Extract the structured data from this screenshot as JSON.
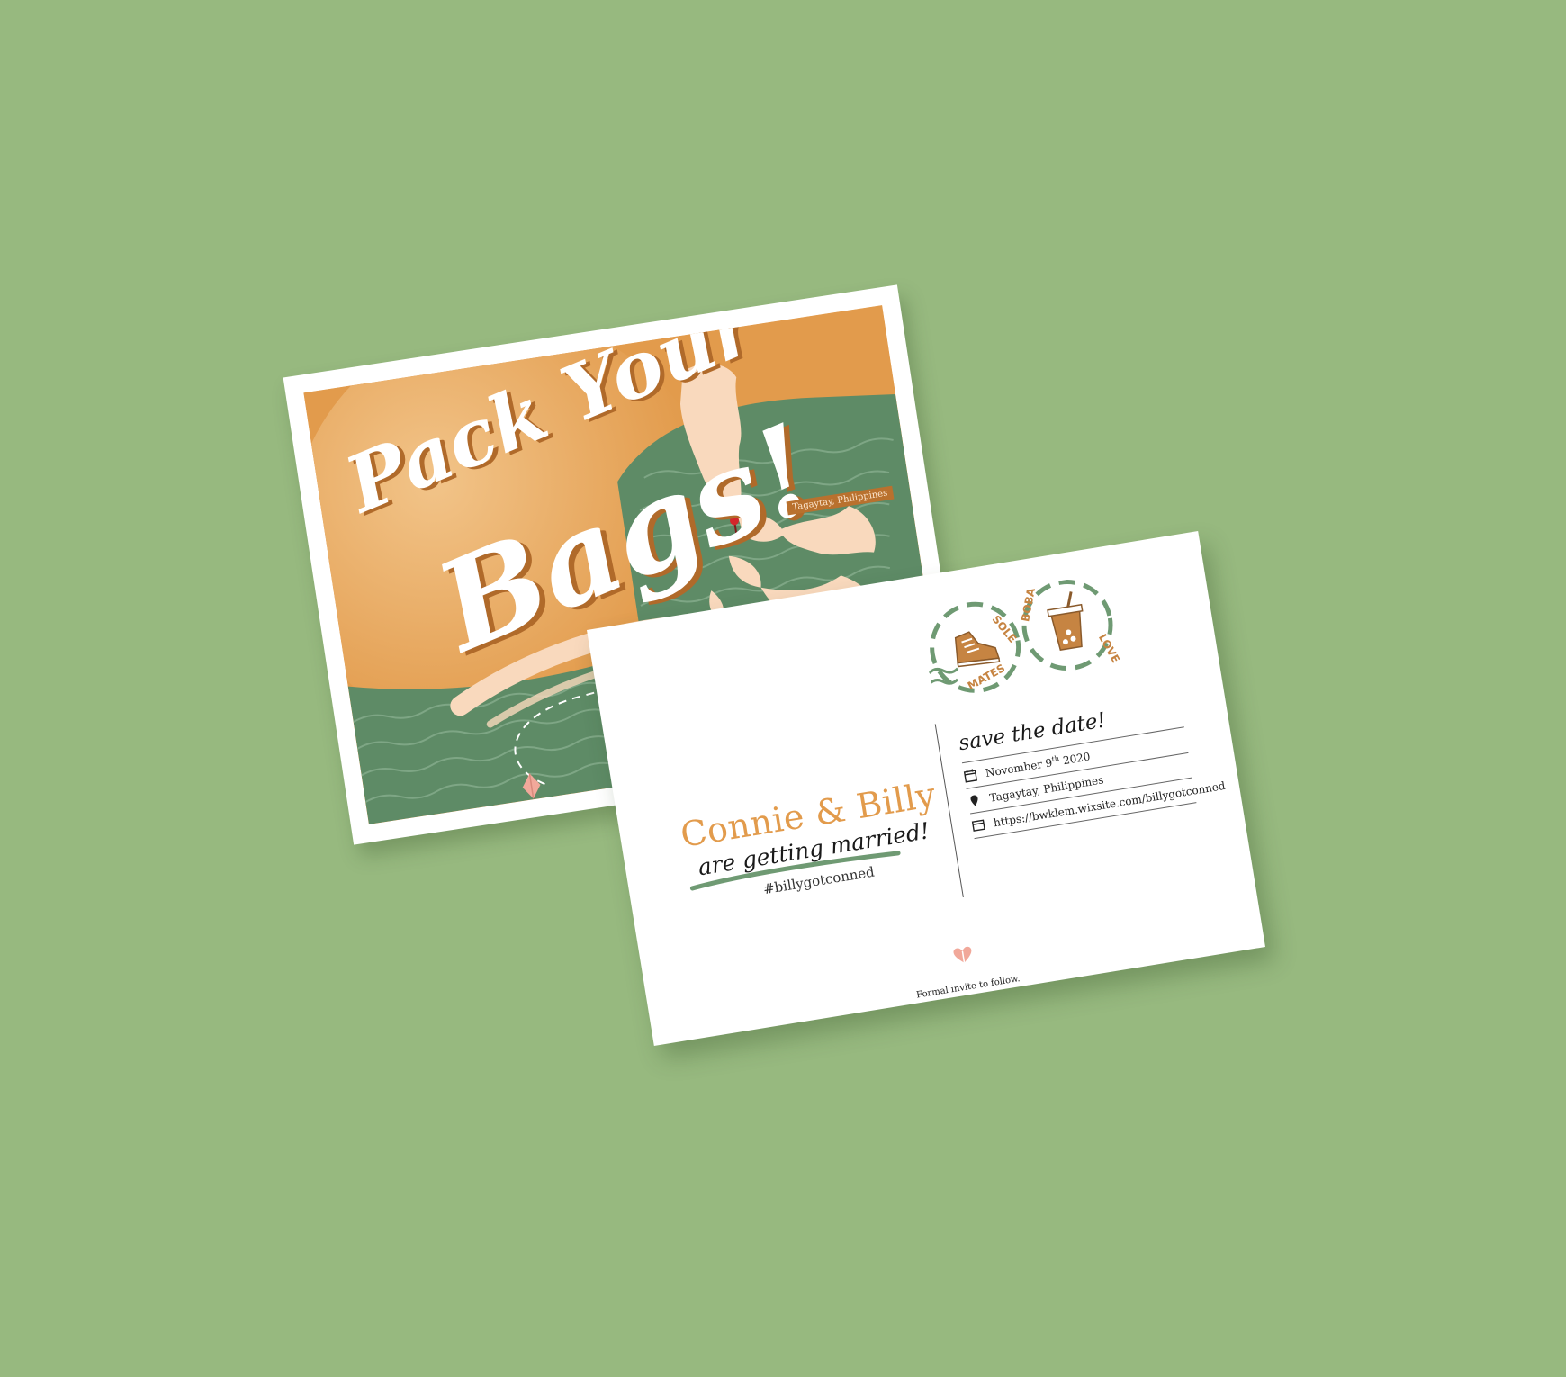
{
  "front": {
    "title_line1": "Pack Your",
    "title_line2": "Bags!",
    "pin_label": "Tagaytay, Philippines"
  },
  "stamps": {
    "left_top": "SOLE",
    "left_bottom": "MATES",
    "right_top": "BOBA",
    "right_bottom": "LOVE"
  },
  "back": {
    "couple": "Connie & Billy",
    "subtitle": "are getting married!",
    "hashtag": "#billygotconned",
    "save_the_date": "save the date!",
    "date_main": "November 9",
    "date_suffix": "th",
    "date_year": " 2020",
    "location": "Tagaytay, Philippines",
    "website": "https://bwklem.wixsite.com/billygotconned",
    "footer_note": "Formal invite to follow."
  },
  "colors": {
    "background": "#97b97f",
    "orange": "#e29b4c",
    "green": "#5e8b66",
    "peach": "#f9d9bd",
    "text": "#1a1a1a"
  }
}
